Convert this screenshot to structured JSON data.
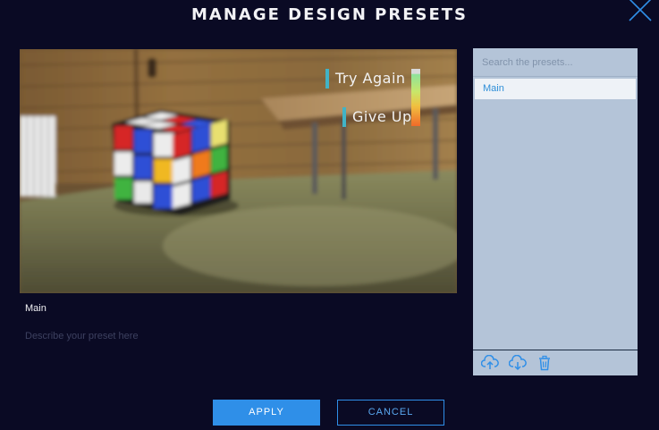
{
  "dialog": {
    "title": "MANAGE DESIGN PRESETS"
  },
  "preview": {
    "hud_try_again": "Try Again",
    "hud_give_up": "Give Up"
  },
  "preset": {
    "name": "Main",
    "description_value": "",
    "description_placeholder": "Describe your preset here"
  },
  "presets_panel": {
    "search_placeholder": "Search the presets...",
    "items": [
      {
        "label": "Main",
        "selected": true
      }
    ]
  },
  "footer": {
    "apply_label": "APPLY",
    "cancel_label": "CANCEL"
  },
  "colors": {
    "background": "#0a0a24",
    "accent": "#2f8fe8",
    "panel": "#b4c4d8",
    "hud_bar": "#41b3c6"
  },
  "icons": {
    "close": "close-icon",
    "upload": "cloud-upload-icon",
    "download": "cloud-download-icon",
    "delete": "trash-icon"
  }
}
